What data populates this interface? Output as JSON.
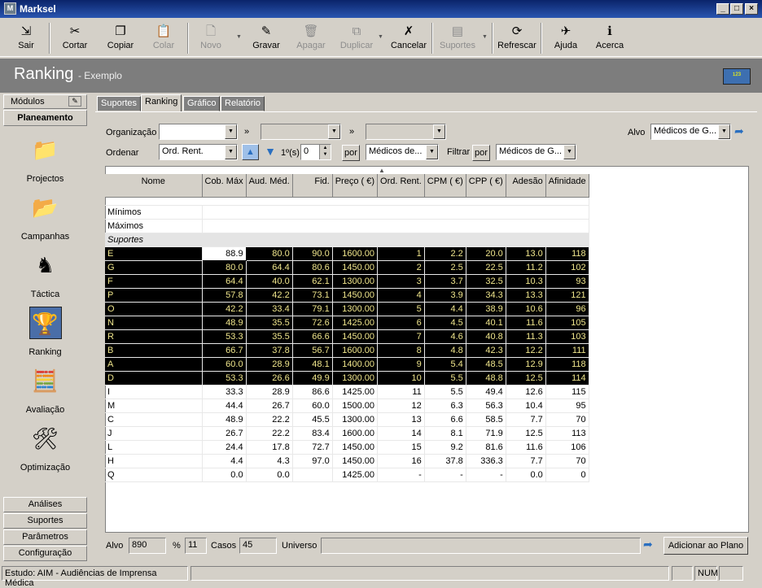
{
  "window": {
    "title": "Marksel",
    "icon_text": "M"
  },
  "toolbar": [
    {
      "label": "Sair",
      "icon": "exit-icon",
      "glyph": "⇲",
      "enabled": true
    },
    {
      "label": "Cortar",
      "icon": "scissors-icon",
      "glyph": "✂",
      "enabled": true
    },
    {
      "label": "Copiar",
      "icon": "copy-icon",
      "glyph": "❐",
      "enabled": true
    },
    {
      "label": "Colar",
      "icon": "paste-icon",
      "glyph": "📋",
      "enabled": false
    },
    {
      "label": "Novo",
      "icon": "new-icon",
      "glyph": "🗋",
      "enabled": false
    },
    {
      "label": "Gravar",
      "icon": "save-icon",
      "glyph": "✎",
      "enabled": true
    },
    {
      "label": "Apagar",
      "icon": "trash-icon",
      "glyph": "🗑",
      "enabled": false
    },
    {
      "label": "Duplicar",
      "icon": "duplicate-icon",
      "glyph": "⧉",
      "enabled": false
    },
    {
      "label": "Cancelar",
      "icon": "cancel-icon",
      "glyph": "✗",
      "enabled": true
    },
    {
      "label": "Suportes",
      "icon": "supports-icon",
      "glyph": "▤",
      "enabled": false
    },
    {
      "label": "Refrescar",
      "icon": "refresh-icon",
      "glyph": "⟳",
      "enabled": true
    },
    {
      "label": "Ajuda",
      "icon": "help-icon",
      "glyph": "✈",
      "enabled": true
    },
    {
      "label": "Acerca",
      "icon": "info-icon",
      "glyph": "ℹ",
      "enabled": true
    }
  ],
  "header": {
    "title": "Ranking",
    "subtitle": "- Exemplo"
  },
  "left": {
    "modules_label": "Módulos",
    "section": "Planeamento",
    "items": [
      {
        "label": "Projectos",
        "icon": "folder-camera-icon",
        "glyph": "📁"
      },
      {
        "label": "Campanhas",
        "icon": "campaign-icon",
        "glyph": "📂"
      },
      {
        "label": "Táctica",
        "icon": "chess-knight-icon",
        "glyph": "♞"
      },
      {
        "label": "Ranking",
        "icon": "podium-icon",
        "glyph": "🏆"
      },
      {
        "label": "Avaliação",
        "icon": "calculator-icon",
        "glyph": "🧮"
      },
      {
        "label": "Optimização",
        "icon": "tools-icon",
        "glyph": "🛠"
      }
    ],
    "bottom": [
      "Análises",
      "Suportes",
      "Parâmetros",
      "Configuração"
    ]
  },
  "tabs": [
    "Suportes",
    "Ranking",
    "Gráfico",
    "Relatório"
  ],
  "form": {
    "organizacao_label": "Organização",
    "organizacao_value": "",
    "chevrons": "»",
    "alvo_label": "Alvo",
    "alvo_value": "Médicos de G...",
    "ordenar_label": "Ordenar",
    "ordenar_value": "Ord. Rent.",
    "first_label": "1º(s)",
    "first_value": "0",
    "por_label": "por",
    "por_value": "Médicos de...",
    "filtrar_label": "Filtrar",
    "filtrar_por_label": "por",
    "filtrar_value": "Médicos de G..."
  },
  "grid": {
    "columns": [
      "Nome",
      "Cob. Máx",
      "Aud. Méd.",
      "Fid.",
      "Preço ( €)",
      "Ord. Rent.",
      "CPM ( €)",
      "CPP ( €)",
      "Adesão",
      "Afinidade"
    ],
    "minimos_label": "Mínimos",
    "maximos_label": "Máximos",
    "section_label": "Suportes",
    "rows": [
      [
        "E",
        "88.9",
        "80.0",
        "90.0",
        "1600.00",
        "1",
        "2.2",
        "20.0",
        "13.0",
        "118"
      ],
      [
        "G",
        "80.0",
        "64.4",
        "80.6",
        "1450.00",
        "2",
        "2.5",
        "22.5",
        "11.2",
        "102"
      ],
      [
        "F",
        "64.4",
        "40.0",
        "62.1",
        "1300.00",
        "3",
        "3.7",
        "32.5",
        "10.3",
        "93"
      ],
      [
        "P",
        "57.8",
        "42.2",
        "73.1",
        "1450.00",
        "4",
        "3.9",
        "34.3",
        "13.3",
        "121"
      ],
      [
        "O",
        "42.2",
        "33.4",
        "79.1",
        "1300.00",
        "5",
        "4.4",
        "38.9",
        "10.6",
        "96"
      ],
      [
        "N",
        "48.9",
        "35.5",
        "72.6",
        "1425.00",
        "6",
        "4.5",
        "40.1",
        "11.6",
        "105"
      ],
      [
        "R",
        "53.3",
        "35.5",
        "66.6",
        "1450.00",
        "7",
        "4.6",
        "40.8",
        "11.3",
        "103"
      ],
      [
        "B",
        "66.7",
        "37.8",
        "56.7",
        "1600.00",
        "8",
        "4.8",
        "42.3",
        "12.2",
        "111"
      ],
      [
        "A",
        "60.0",
        "28.9",
        "48.1",
        "1400.00",
        "9",
        "5.4",
        "48.5",
        "12.9",
        "118"
      ],
      [
        "D",
        "53.3",
        "26.6",
        "49.9",
        "1300.00",
        "10",
        "5.5",
        "48.8",
        "12.5",
        "114"
      ],
      [
        "I",
        "33.3",
        "28.9",
        "86.6",
        "1425.00",
        "11",
        "5.5",
        "49.4",
        "12.6",
        "115"
      ],
      [
        "M",
        "44.4",
        "26.7",
        "60.0",
        "1500.00",
        "12",
        "6.3",
        "56.3",
        "10.4",
        "95"
      ],
      [
        "C",
        "48.9",
        "22.2",
        "45.5",
        "1300.00",
        "13",
        "6.6",
        "58.5",
        "7.7",
        "70"
      ],
      [
        "J",
        "26.7",
        "22.2",
        "83.4",
        "1600.00",
        "14",
        "8.1",
        "71.9",
        "12.5",
        "113"
      ],
      [
        "L",
        "24.4",
        "17.8",
        "72.7",
        "1450.00",
        "15",
        "9.2",
        "81.6",
        "11.6",
        "106"
      ],
      [
        "H",
        "4.4",
        "4.3",
        "97.0",
        "1450.00",
        "16",
        "37.8",
        "336.3",
        "7.7",
        "70"
      ],
      [
        "Q",
        "0.0",
        "0.0",
        "",
        "1425.00",
        "-",
        "-",
        "-",
        "0.0",
        "0"
      ]
    ],
    "highlighted_count": 10
  },
  "footer": {
    "alvo_label": "Alvo",
    "alvo_value": "890",
    "pct_label": "%",
    "pct_value": "11",
    "casos_label": "Casos",
    "casos_value": "45",
    "universo_label": "Universo",
    "universo_value": "",
    "add_button": "Adicionar ao Plano"
  },
  "status": {
    "study": "Estudo: AIM - Audiências de Imprensa Médica",
    "num": "NUM"
  }
}
